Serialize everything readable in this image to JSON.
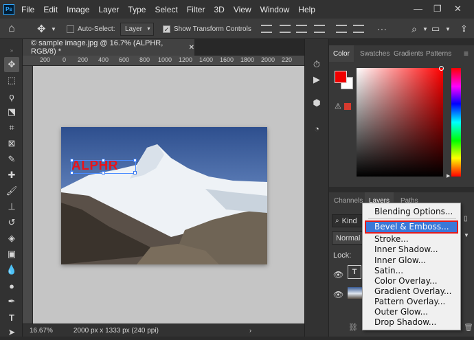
{
  "app": {
    "logo_text": "Ps",
    "accent": "#31a8ff"
  },
  "menu": [
    "File",
    "Edit",
    "Image",
    "Layer",
    "Type",
    "Select",
    "Filter",
    "3D",
    "View",
    "Window",
    "Help"
  ],
  "window_controls": {
    "minimize": "—",
    "restore": "❐",
    "close": "✕"
  },
  "options_bar": {
    "auto_select_label": "Auto-Select:",
    "auto_select_value": "Layer",
    "show_transform_label": "Show Transform Controls"
  },
  "document": {
    "tab_title": "© sample image.jpg @ 16.7% (ALPHR, RGB/8) *",
    "close_glyph": "✕",
    "text_layer": "ALPHR",
    "text_color": "#e8141c"
  },
  "ruler": {
    "ticks": [
      "200",
      "0",
      "200",
      "400",
      "600",
      "800",
      "1000",
      "1200",
      "1400",
      "1600",
      "1800",
      "2000",
      "220"
    ]
  },
  "status": {
    "zoom": "16.67%",
    "doc_info": "2000 px x 1333 px (240 ppi)"
  },
  "color_panel": {
    "tabs": [
      "Color",
      "Swatches",
      "Gradients",
      "Patterns"
    ],
    "foreground": "#f00000",
    "background": "#ffffff"
  },
  "layers_panel": {
    "tabs": [
      "Channels",
      "Layers",
      "Paths"
    ],
    "filter_label": "Kind",
    "blend_mode": "Normal",
    "lock_label": "Lock:",
    "text_layer_thumb": "T"
  },
  "context_menu": {
    "items": [
      "Blending Options...",
      "Bevel & Emboss...",
      "Stroke...",
      "Inner Shadow...",
      "Inner Glow...",
      "Satin...",
      "Color Overlay...",
      "Gradient Overlay...",
      "Pattern Overlay...",
      "Outer Glow...",
      "Drop Shadow..."
    ],
    "highlighted": "Bevel & Emboss...",
    "highlight_color": "#3a78d8",
    "outline_color": "#e51a1a"
  }
}
